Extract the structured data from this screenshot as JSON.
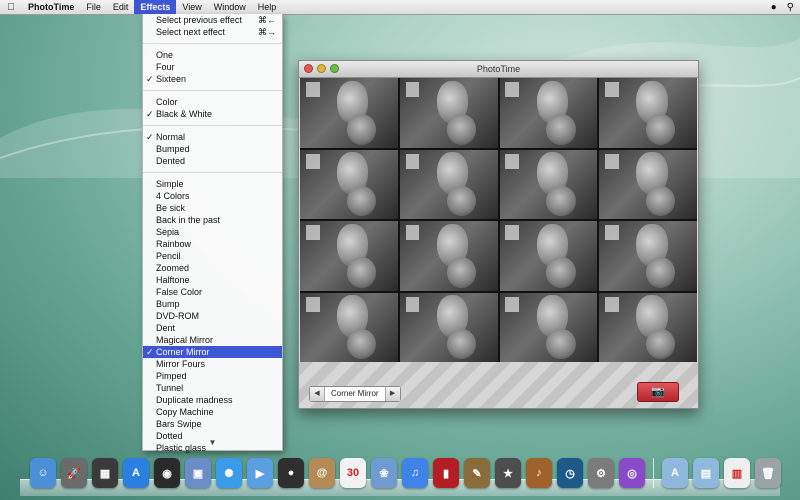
{
  "menubar": {
    "app": "PhotoTime",
    "items": [
      "File",
      "Edit",
      "Effects",
      "View",
      "Window",
      "Help"
    ],
    "active": "Effects"
  },
  "menu": {
    "nav": [
      {
        "label": "Select previous effect",
        "shortcut": "⌘←"
      },
      {
        "label": "Select next effect",
        "shortcut": "⌘→"
      }
    ],
    "grid": [
      {
        "label": "One",
        "checked": false
      },
      {
        "label": "Four",
        "checked": false
      },
      {
        "label": "Sixteen",
        "checked": true
      }
    ],
    "color": [
      {
        "label": "Color",
        "checked": false
      },
      {
        "label": "Black & White",
        "checked": true
      }
    ],
    "distortion": [
      {
        "label": "Normal",
        "checked": true
      },
      {
        "label": "Bumped",
        "checked": false
      },
      {
        "label": "Dented",
        "checked": false
      }
    ],
    "effects": [
      {
        "label": "Simple",
        "checked": false
      },
      {
        "label": "4 Colors",
        "checked": false
      },
      {
        "label": "Be sick",
        "checked": false
      },
      {
        "label": "Back in the past",
        "checked": false
      },
      {
        "label": "Sepia",
        "checked": false
      },
      {
        "label": "Rainbow",
        "checked": false
      },
      {
        "label": "Pencil",
        "checked": false
      },
      {
        "label": "Zoomed",
        "checked": false
      },
      {
        "label": "Halftone",
        "checked": false
      },
      {
        "label": "False Color",
        "checked": false
      },
      {
        "label": "Bump",
        "checked": false
      },
      {
        "label": "DVD-ROM",
        "checked": false
      },
      {
        "label": "Dent",
        "checked": false
      },
      {
        "label": "Magical Mirror",
        "checked": false
      },
      {
        "label": "Corner Mirror",
        "checked": true
      },
      {
        "label": "Mirror Fours",
        "checked": false
      },
      {
        "label": "Pimped",
        "checked": false
      },
      {
        "label": "Tunnel",
        "checked": false
      },
      {
        "label": "Duplicate madness",
        "checked": false
      },
      {
        "label": "Copy Machine",
        "checked": false
      },
      {
        "label": "Bars Swipe",
        "checked": false
      },
      {
        "label": "Dotted",
        "checked": false
      },
      {
        "label": "Plastic glass",
        "checked": false
      }
    ]
  },
  "window": {
    "title": "PhotoTime",
    "current_effect": "Corner Mirror",
    "prev_glyph": "◀",
    "next_glyph": "▶",
    "camera_glyph": "📷"
  },
  "dock": {
    "apps": [
      {
        "icon": "finder-icon",
        "color": "#4a8fd8",
        "glyph": "☺"
      },
      {
        "icon": "launchpad-icon",
        "color": "#6b6b6b",
        "glyph": "🚀"
      },
      {
        "icon": "mission-control-icon",
        "color": "#3a3a3a",
        "glyph": "▦"
      },
      {
        "icon": "app-store-icon",
        "color": "#2b7fe0",
        "glyph": "A"
      },
      {
        "icon": "dashboard-icon",
        "color": "#2a2a2a",
        "glyph": "◉"
      },
      {
        "icon": "preview-icon",
        "color": "#6a8cc7",
        "glyph": "▣"
      },
      {
        "icon": "safari-icon",
        "color": "#3a9be8",
        "glyph": "✺"
      },
      {
        "icon": "facetime-icon",
        "color": "#5aa0e0",
        "glyph": "▶"
      },
      {
        "icon": "photobooth-icon",
        "color": "#2f2f2f",
        "glyph": "●"
      },
      {
        "icon": "contacts-icon",
        "color": "#b58a55",
        "glyph": "@"
      },
      {
        "icon": "calendar-icon",
        "color": "#f2f2f2",
        "glyph": "30"
      },
      {
        "icon": "iphoto-icon",
        "color": "#6e9bd0",
        "glyph": "❀"
      },
      {
        "icon": "itunes-icon",
        "color": "#3f83e6",
        "glyph": "♫"
      },
      {
        "icon": "photo-booth-app-icon",
        "color": "#b21e24",
        "glyph": "▮"
      },
      {
        "icon": "photo-app-icon",
        "color": "#8a6b3a",
        "glyph": "✎"
      },
      {
        "icon": "imovie-icon",
        "color": "#4d4d4d",
        "glyph": "★"
      },
      {
        "icon": "garageband-icon",
        "color": "#a0622d",
        "glyph": "♪"
      },
      {
        "icon": "time-machine-icon",
        "color": "#1d5a8a",
        "glyph": "◷"
      },
      {
        "icon": "system-preferences-icon",
        "color": "#7b7b7b",
        "glyph": "⚙"
      },
      {
        "icon": "color-picker-icon",
        "color": "#8a4ac7",
        "glyph": "◎"
      }
    ],
    "right": [
      {
        "icon": "applications-folder-icon",
        "color": "#8fb8dd",
        "glyph": "A"
      },
      {
        "icon": "documents-folder-icon",
        "color": "#8fb8dd",
        "glyph": "▤"
      },
      {
        "icon": "downloads-stack-icon",
        "color": "#eeeeee",
        "glyph": "▥"
      },
      {
        "icon": "trash-icon",
        "color": "#9aa3a6",
        "glyph": "🗑"
      }
    ]
  }
}
